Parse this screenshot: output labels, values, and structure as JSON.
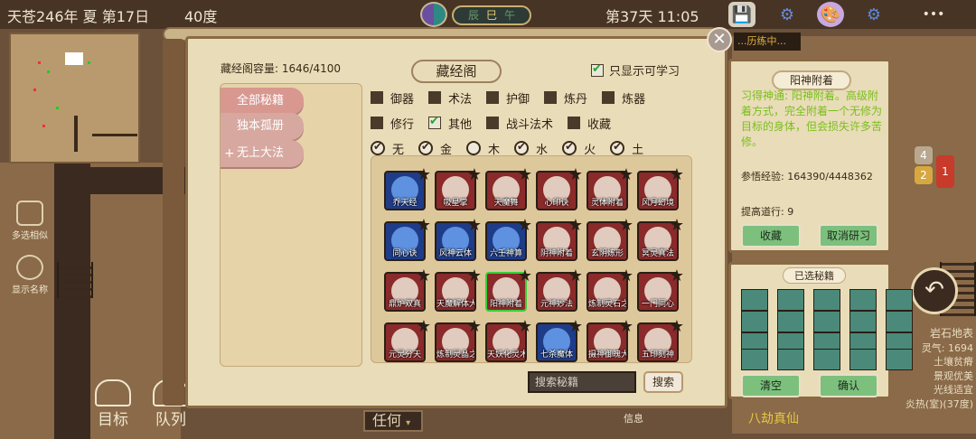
{
  "status": {
    "date": "天苍246年 夏 第17日",
    "temperature": "40度",
    "shichen": [
      "辰",
      "巳",
      "午"
    ],
    "time": "第37天 11:05"
  },
  "hud": {
    "multi_select": "多选相似",
    "show_names": "显示名称",
    "goal": "目标",
    "team": "队列",
    "any_filter": "任何",
    "info": "信息",
    "title_tag": "八劫真仙",
    "task_tag": "...历练中...",
    "badges": [
      "4",
      "2",
      "1"
    ]
  },
  "right_info": {
    "terrain": "岩石地表",
    "spirit": "灵气: 1694",
    "soil": "土壤贫瘠",
    "view": "景观优美",
    "light": "光线适宜",
    "temp": "炎热(室)(37度)"
  },
  "library": {
    "capacity": "藏经阁容量: 1646/4100",
    "title": "藏经阁",
    "only_learnable": "只显示可学习",
    "categories": [
      {
        "label": "全部秘籍"
      },
      {
        "label": "独本孤册"
      },
      {
        "label": "无上大法"
      }
    ],
    "filters_row1": [
      {
        "label": "御器",
        "checked": false
      },
      {
        "label": "术法",
        "checked": false
      },
      {
        "label": "护御",
        "checked": false
      },
      {
        "label": "炼丹",
        "checked": false
      },
      {
        "label": "炼器",
        "checked": false
      }
    ],
    "filters_row2": [
      {
        "label": "修行",
        "checked": false
      },
      {
        "label": "其他",
        "checked": true
      },
      {
        "label": "战斗法术",
        "checked": false
      },
      {
        "label": "收藏",
        "checked": false
      }
    ],
    "elements": [
      {
        "label": "无",
        "checked": true
      },
      {
        "label": "金",
        "checked": true
      },
      {
        "label": "木",
        "checked": false
      },
      {
        "label": "水",
        "checked": true
      },
      {
        "label": "火",
        "checked": true
      },
      {
        "label": "土",
        "checked": true
      }
    ],
    "books": [
      {
        "name": "乔天经",
        "color": "blue"
      },
      {
        "name": "吸星掌",
        "color": "red"
      },
      {
        "name": "天魔舞",
        "color": "red"
      },
      {
        "name": "心印诀",
        "color": "red"
      },
      {
        "name": "灵体附着",
        "color": "red"
      },
      {
        "name": "风月幻境",
        "color": "red"
      },
      {
        "name": "同心诀",
        "color": "blue"
      },
      {
        "name": "风神云体",
        "color": "blue"
      },
      {
        "name": "六壬神算",
        "color": "blue"
      },
      {
        "name": "阴神附着",
        "color": "red"
      },
      {
        "name": "玄阴炼形",
        "color": "red"
      },
      {
        "name": "冥灵真法",
        "color": "red"
      },
      {
        "name": "鼎炉双真",
        "color": "red"
      },
      {
        "name": "天魔解体大法",
        "color": "red"
      },
      {
        "name": "阳神附着",
        "color": "red",
        "selected": true
      },
      {
        "name": "元神妙法",
        "color": "red"
      },
      {
        "name": "炼制灵石之术",
        "color": "red"
      },
      {
        "name": "一门同心",
        "color": "red"
      },
      {
        "name": "元灵分天",
        "color": "red"
      },
      {
        "name": "炼制灵晶之术",
        "color": "red"
      },
      {
        "name": "天妖化灵术",
        "color": "red"
      },
      {
        "name": "七杀魔体",
        "color": "blue"
      },
      {
        "name": "摄神御魄大法",
        "color": "red"
      },
      {
        "name": "五印刻神",
        "color": "red"
      }
    ],
    "search_placeholder": "搜索秘籍",
    "search_label": "搜索"
  },
  "detail": {
    "title": "阳神附着",
    "description": "习得神通: 阳神附着。高级附着方式，完全附着一个无修为目标的身体，但会损失许多苦修。",
    "exp_label": "参悟经验:",
    "exp_value": "164390/4448362",
    "dao_label": "提高道行:",
    "dao_value": "9",
    "collect": "收藏",
    "cancel_study": "取消研习"
  },
  "chosen": {
    "title": "已选秘籍",
    "clear": "清空",
    "confirm": "确认"
  },
  "colors": {
    "parchment": "#e9dcb8",
    "frame": "#8a6a44",
    "desc_green": "#7ac01c",
    "button_green": "#7dc07d",
    "book_red": "#8a2a2a",
    "book_blue": "#1f3c88"
  }
}
